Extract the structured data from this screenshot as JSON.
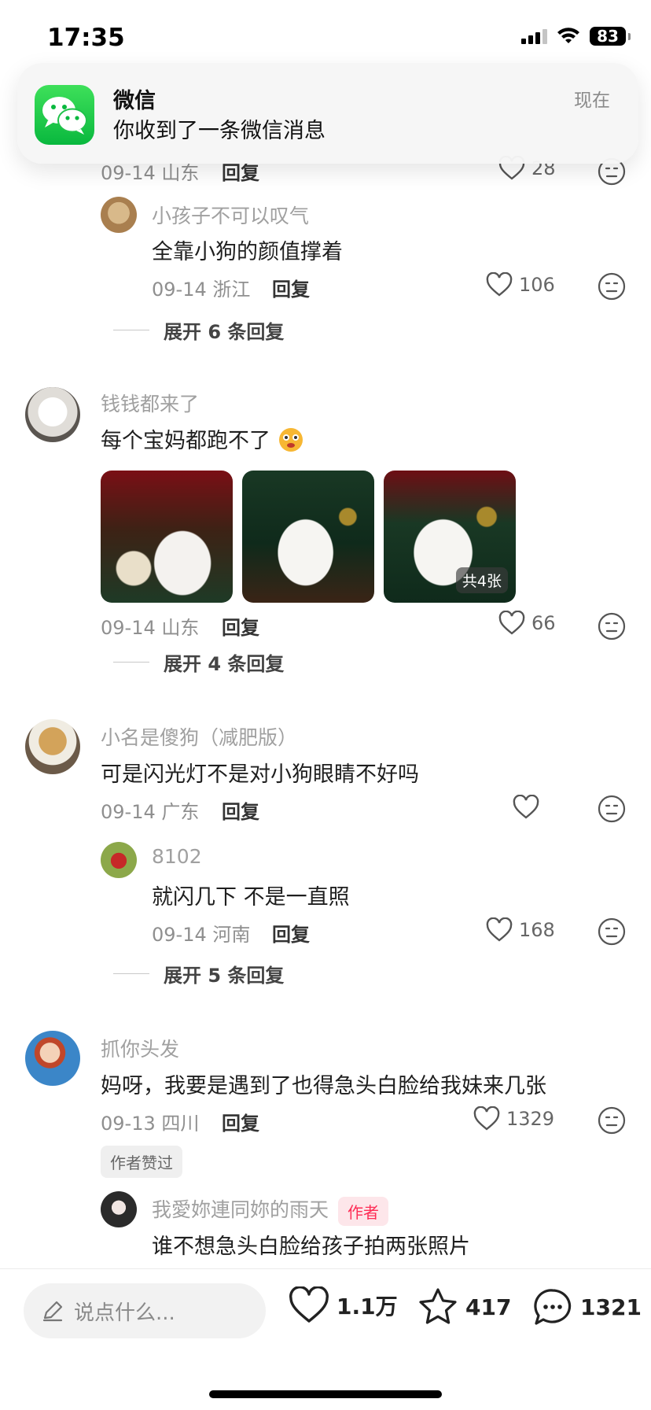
{
  "status_bar": {
    "time": "17:35",
    "battery": "83"
  },
  "notification": {
    "app": "微信",
    "message": "你收到了一条微信消息",
    "time": "现在"
  },
  "comments": {
    "partial": {
      "date": "09-14 山东",
      "reply": "回复",
      "likes": "28"
    },
    "c1_reply": {
      "user": "小孩子不可以叹气",
      "text": "全靠小狗的颜值撑着",
      "date": "09-14 浙江",
      "reply": "回复",
      "likes": "106"
    },
    "expand1": "展开 6 条回复",
    "c2": {
      "user": "钱钱都来了",
      "text": "每个宝妈都跑不了",
      "photo_count": "共4张",
      "date": "09-14 山东",
      "reply": "回复",
      "likes": "66"
    },
    "expand2": "展开 4 条回复",
    "c3": {
      "user": "小名是傻狗（减肥版）",
      "text": "可是闪光灯不是对小狗眼睛不好吗",
      "date": "09-14 广东",
      "reply": "回复"
    },
    "c3_reply": {
      "user": "8102",
      "text": "就闪几下 不是一直照",
      "date": "09-14 河南",
      "reply": "回复",
      "likes": "168"
    },
    "expand3": "展开 5 条回复",
    "c4": {
      "user": "抓你头发",
      "text": "妈呀，我要是遇到了也得急头白脸给我妹来几张",
      "date": "09-13 四川",
      "reply": "回复",
      "likes": "1329",
      "author_liked": "作者赞过"
    },
    "c4_reply": {
      "user": "我愛妳連同妳的雨天",
      "author_tag": "作者",
      "text": "谁不想急头白脸给孩子拍两张照片"
    }
  },
  "bottom_bar": {
    "placeholder": "说点什么...",
    "likes": "1.1万",
    "favorites": "417",
    "comments": "1321"
  },
  "colors": {
    "accent": "#fe2c55",
    "wechat": "#09b83e",
    "meta": "#8f8f8f"
  },
  "icons": [
    "signal-icon",
    "wifi-icon",
    "battery-icon",
    "wechat-icon",
    "heart-icon",
    "dislike-icon",
    "pencil-icon",
    "star-icon",
    "comment-icon"
  ]
}
